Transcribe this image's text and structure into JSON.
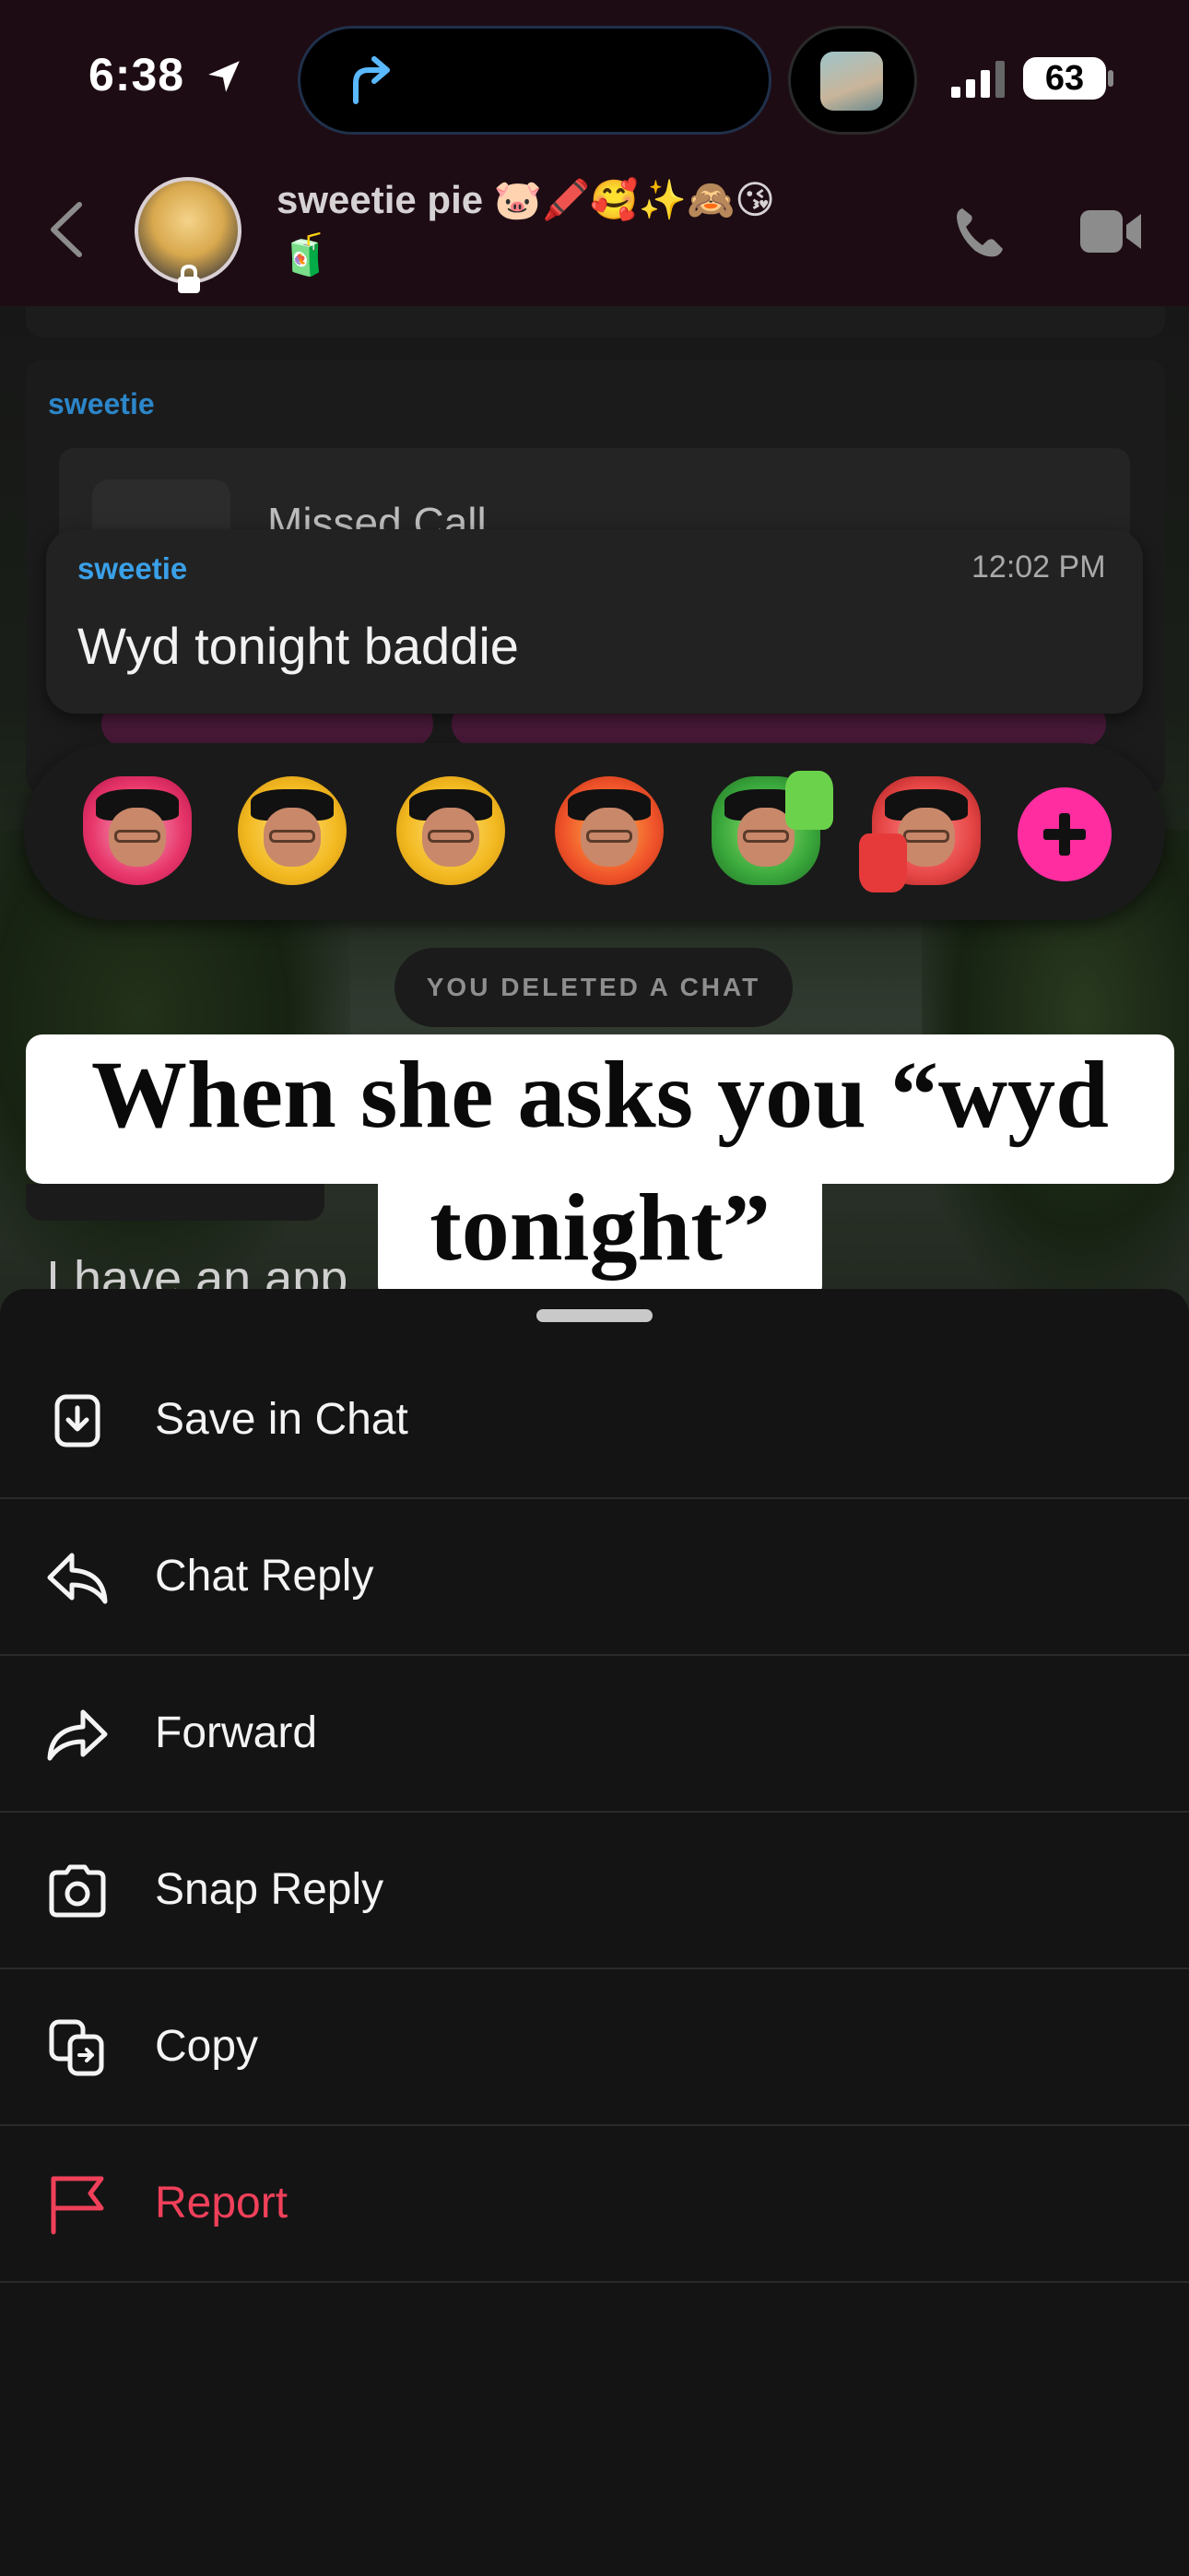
{
  "status_bar": {
    "time": "6:38",
    "battery": "63"
  },
  "header": {
    "contact_name": "sweetie pie 🐷🖍️🥰✨🙈😘",
    "contact_name_line2": "🧃"
  },
  "background_chat": {
    "sender": "sweetie",
    "missed_call_label": "Missed Call",
    "deleted_notice": "YOU DELETED A CHAT",
    "partial_text": "I have an app"
  },
  "highlighted_message": {
    "sender": "sweetie",
    "time": "12:02 PM",
    "text": "Wyd tonight baddie"
  },
  "reactions": [
    {
      "name": "heart-bitmoji"
    },
    {
      "name": "laughing-bitmoji"
    },
    {
      "name": "crying-bitmoji"
    },
    {
      "name": "fire-bitmoji"
    },
    {
      "name": "thumbs-up-bitmoji"
    },
    {
      "name": "thumbs-down-bitmoji"
    }
  ],
  "caption": {
    "line1": "When she asks you “wyd",
    "line2": "tonight”"
  },
  "menu": {
    "items": [
      {
        "label": "Save in Chat",
        "icon": "save-icon"
      },
      {
        "label": "Chat Reply",
        "icon": "reply-icon"
      },
      {
        "label": "Forward",
        "icon": "forward-icon"
      },
      {
        "label": "Snap Reply",
        "icon": "camera-icon"
      },
      {
        "label": "Copy",
        "icon": "copy-icon"
      },
      {
        "label": "Report",
        "icon": "flag-icon"
      }
    ]
  },
  "colors": {
    "accent_blue": "#3aa0e8",
    "report_red": "#f0405a",
    "add_reaction_pink": "#ff2da0"
  }
}
